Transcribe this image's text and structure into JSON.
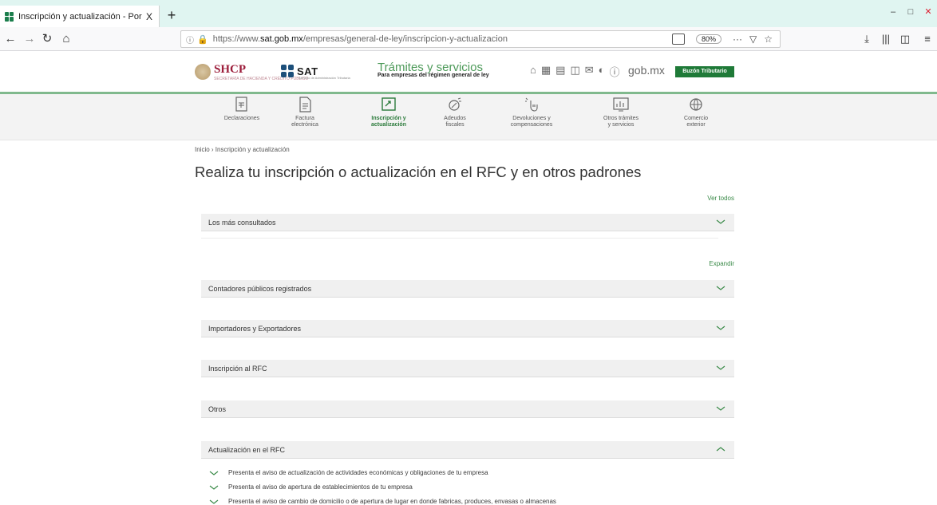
{
  "browser": {
    "tab_title": "Inscripción y actualización - Por",
    "tab_close": "X",
    "new_tab": "+",
    "url_prefix": "https://www.",
    "url_domain": "sat.gob.mx",
    "url_path": "/empresas/general-de-ley/inscripcion-y-actualizacion",
    "zoom": "80%",
    "more": "···"
  },
  "header": {
    "shcp": "SHCP",
    "shcp_sub": "SECRETARÍA DE HACIENDA Y CRÉDITO PÚBLICO",
    "sat": "SAT",
    "sat_sub": "Servicio de Administración Tributaria",
    "tramites": "Trámites y servicios",
    "tramites_sub": "Para empresas del régimen general de ley",
    "gobmx": "gob.mx",
    "buzon": "Buzón Tributario"
  },
  "categories": [
    {
      "label": "Declaraciones"
    },
    {
      "label": "Factura\nelectrónica"
    },
    {
      "label": "Inscripción y\nactualización"
    },
    {
      "label": "Adeudos\nfiscales"
    },
    {
      "label": "Devoluciones y\ncompensaciones"
    },
    {
      "label": "Otros trámites\ny servicios"
    },
    {
      "label": "Comercio\nexterior"
    }
  ],
  "breadcrumb": "Inicio › Inscripción y actualización",
  "page_title": "Realiza tu inscripción o actualización en el RFC y en otros padrones",
  "ver_todos": "Ver todos",
  "expandir": "Expandir",
  "sections": {
    "mas_consultados": "Los más consultados",
    "contadores": "Contadores públicos registrados",
    "importadores": "Importadores y Exportadores",
    "inscripcion": "Inscripción al RFC",
    "otros": "Otros",
    "actualizacion": "Actualización en el RFC"
  },
  "actualizacion_items": [
    "Presenta el aviso de actualización de actividades económicas y obligaciones de tu empresa",
    "Presenta el aviso de apertura de establecimientos de tu empresa",
    "Presenta el aviso de cambio de domicilio o de apertura de lugar en donde fabricas, produces, envasas o almacenas"
  ],
  "colors": {
    "accent_green": "#3a8a48",
    "brand_maroon": "#9c1c3a",
    "buzon_green": "#1f7a38"
  }
}
